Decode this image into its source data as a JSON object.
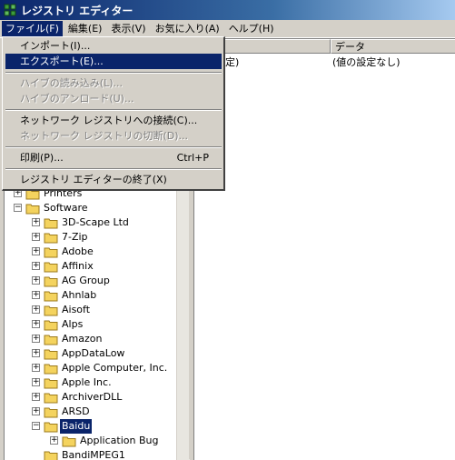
{
  "window": {
    "title": "レジストリ エディター"
  },
  "menubar": {
    "items": [
      "ファイル(F)",
      "編集(E)",
      "表示(V)",
      "お気に入り(A)",
      "ヘルプ(H)"
    ]
  },
  "file_menu": {
    "items": [
      {
        "label": "インポート(I)...",
        "state": "enabled"
      },
      {
        "label": "エクスポート(E)...",
        "state": "highlighted"
      },
      {
        "label": "ハイブの読み込み(L)...",
        "state": "disabled"
      },
      {
        "label": "ハイブのアンロード(U)...",
        "state": "disabled"
      },
      {
        "label": "ネットワーク レジストリへの接続(C)...",
        "state": "enabled"
      },
      {
        "label": "ネットワーク レジストリの切断(D)...",
        "state": "disabled"
      },
      {
        "label": "印刷(P)...",
        "state": "enabled",
        "shortcut": "Ctrl+P"
      },
      {
        "label": "レジストリ エディターの終了(X)",
        "state": "enabled"
      }
    ]
  },
  "list": {
    "columns": [
      "データ"
    ],
    "rows": [
      {
        "type_partial": "定)",
        "data": "(値の設定なし)"
      }
    ]
  },
  "tree": {
    "nodes": [
      {
        "label": "Printers",
        "level": 1,
        "expander": "+"
      },
      {
        "label": "Software",
        "level": 1,
        "expander": "-"
      },
      {
        "label": "3D-Scape Ltd",
        "level": 2,
        "expander": "+"
      },
      {
        "label": "7-Zip",
        "level": 2,
        "expander": "+"
      },
      {
        "label": "Adobe",
        "level": 2,
        "expander": "+"
      },
      {
        "label": "Affinix",
        "level": 2,
        "expander": "+"
      },
      {
        "label": "AG Group",
        "level": 2,
        "expander": "+"
      },
      {
        "label": "Ahnlab",
        "level": 2,
        "expander": "+"
      },
      {
        "label": "Aisoft",
        "level": 2,
        "expander": "+"
      },
      {
        "label": "Alps",
        "level": 2,
        "expander": "+"
      },
      {
        "label": "Amazon",
        "level": 2,
        "expander": "+"
      },
      {
        "label": "AppDataLow",
        "level": 2,
        "expander": "+"
      },
      {
        "label": "Apple Computer, Inc.",
        "level": 2,
        "expander": "+"
      },
      {
        "label": "Apple Inc.",
        "level": 2,
        "expander": "+"
      },
      {
        "label": "ArchiverDLL",
        "level": 2,
        "expander": "+"
      },
      {
        "label": "ARSD",
        "level": 2,
        "expander": "+"
      },
      {
        "label": "Baidu",
        "level": 2,
        "expander": "-",
        "selected": true
      },
      {
        "label": "Application Bug",
        "level": 3,
        "expander": "+"
      },
      {
        "label": "BandiMPEG1",
        "level": 2,
        "expander": ""
      }
    ]
  },
  "colors": {
    "selection": "#0a246a",
    "folder": "#f4d35e"
  }
}
